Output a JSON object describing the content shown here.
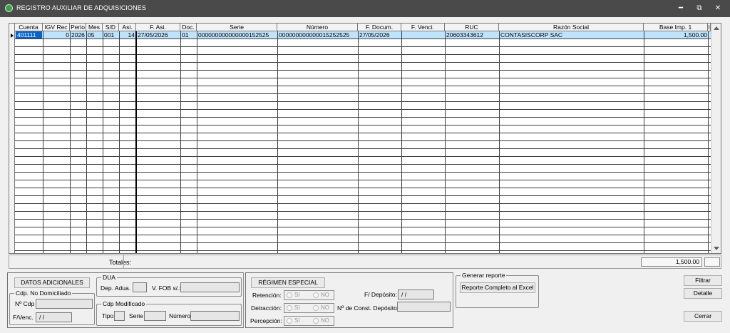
{
  "window": {
    "title": "REGISTRO AUXILIAR DE ADQUISICIONES",
    "minimize": "━",
    "restore": "⧉",
    "close": "✕"
  },
  "grid": {
    "columns": [
      "Cuenta",
      "IGV Rec",
      "Perio",
      "Mes",
      "S/D",
      "Asi.",
      "F. Asi.",
      "Doc.",
      "Serie",
      "Número",
      "F. Docum.",
      "F. Venci.",
      "RUC",
      "Razón Social",
      "Base Imp. 1",
      "I"
    ],
    "rows": [
      {
        "cuenta": "401111",
        "igv_rec": "0",
        "periodo": "2026",
        "mes": "05",
        "sd": "001",
        "asiento": "14",
        "f_asiento": "27/05/2026",
        "doc": "01",
        "serie": "000000000000000152525",
        "numero": "000000000000015252525",
        "f_documento": "27/05/2026",
        "f_vencimiento": "",
        "ruc": "20603343612",
        "razon_social": "CONTASISCORP SAC",
        "base_imp_1": "1,500.00"
      }
    ]
  },
  "totals": {
    "label": "Totales:",
    "base_imp_1": "1,500.00"
  },
  "datos_adicionales": {
    "button": "DATOS ADICIONALES",
    "no_domiciliado": {
      "legend": "Cdp. No Domiciliado",
      "n_cdp_label": "Nº Cdp",
      "n_cdp_value": "",
      "f_venc_label": "F/Venc.",
      "f_venc_value": " /  /"
    },
    "dua": {
      "legend": "DUA",
      "dep_adua_label": "Dep. Adua.",
      "v_fob_label": "V. FOB s/.:"
    },
    "cdp_modificado": {
      "legend": "Cdp Modificado",
      "tipo_label": "Tipo",
      "serie_label": "Serie",
      "numero_label": "Número"
    }
  },
  "regimen_especial": {
    "button": "RÉGIMEN ESPECIAL",
    "retencion_label": "Retención:",
    "detraccion_label": "Detracción:",
    "percepcion_label": "Percepción:",
    "si_label": "SI",
    "no_label": "NO",
    "f_deposito_label": "F/ Depósito:",
    "f_deposito_value": " /  /",
    "n_const_deposito_label": "Nº de Const. Depósito:"
  },
  "generar_reporte": {
    "legend": "Generar reporte",
    "button": "Reporte Completo al Excel"
  },
  "actions": {
    "filtrar": "Filtrar",
    "detalle": "Detalle",
    "cerrar": "Cerrar"
  }
}
